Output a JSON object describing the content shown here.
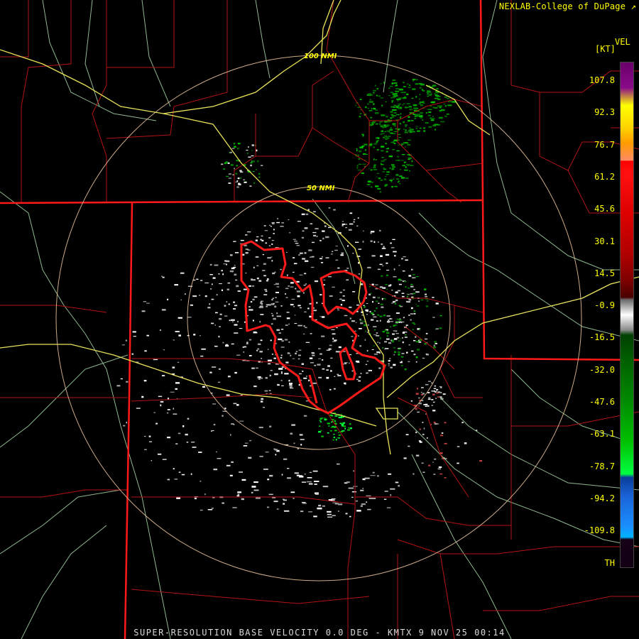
{
  "header": {
    "credit": "NEXLAB-College of DuPage",
    "credit_icon": "external-link-icon"
  },
  "footer": {
    "product_line": "SUPER-RESOLUTION BASE VELOCITY 0.0 DEG - KMTX 9 NOV 25 00:14"
  },
  "rings": {
    "outer_label": "100 NMI",
    "inner_label": "50 NMI"
  },
  "legend": {
    "title": "VEL",
    "unit": "[KT]",
    "ticks": [
      "107.8",
      "92.3",
      "76.7",
      "61.2",
      "45.6",
      "30.1",
      "14.5",
      "-0.9",
      "-16.5",
      "-32.0",
      "-47.6",
      "-63.1",
      "-78.7",
      "-94.2",
      "-109.8",
      "TH"
    ],
    "colors": {
      "purple": "#8a0a8a",
      "yellow": "#ffff00",
      "red": "#ff0000",
      "gray": "#bfbfbf",
      "green": "#00a000",
      "bright_green": "#00ff40",
      "blue": "#1a64d8",
      "cyan": "#00b4ff"
    }
  },
  "map_colors": {
    "state_border": "#ff1a1a",
    "county_line": "#b31313",
    "highway": "#e8e35a",
    "road": "#a8d8a8",
    "range_ring": "#f0c8a0",
    "warning_polygon": "#ff1a1a"
  }
}
